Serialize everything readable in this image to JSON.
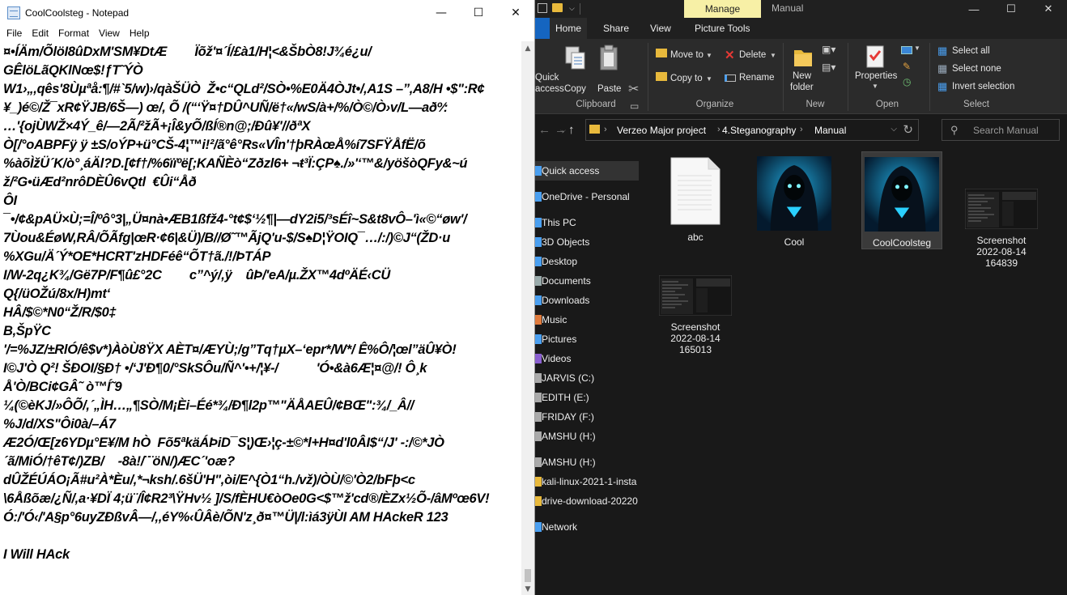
{
  "notepad": {
    "title": "CoolCoolsteg - Notepad",
    "menu": [
      "File",
      "Edit",
      "Format",
      "View",
      "Help"
    ],
    "content_lines": [
      "¤•ÍÄm/ÕlöI8ûDxM'SM¥DtÆ        Ïõž'¤´Í/£à1/H¦<&ŠbÒ8!J¾é¿u/",
      "GÊlöLãQKlNœ$!ƒT˜ÝÒ",
      "W1›„,qês'8Ùµªå:¶/#`5/w)›/qàŠÜÒ  Ž•c“QLd²/SÒ•%E0Ä4ÒJt•/,A1S –”,A8/H •$\":R¢",
      "¥_)é©/Ž¯xR¢ŸJB/6Š—) œ/, Õ /(“‘Ÿ¤†DÛ^UÑ/ë†«/wS/à+/%/Ò©/Ò›v/L—aðº⁄:",
      "…'{ojÙWŽ×4Ý_ê/—2Ã/²žÃ+¡Î&yÕ/ßÍ®n@;/Ðû¥'//ðªX",
      "Ò[/°oABPFÿ ÿ ±S/oÝP+ü°CŠ-4¦™i!²/ã°ê°Rs«VÎn'†þRÀœÅ%í7SFŸÅfË/õ",
      "%àõÌžÜ´K/ò°¸áÄl?D.[¢f†/%6ïïºë[;KAÑÈò“Zðzl6+ ¬ŧ³Ï:ÇP♠./»'‘™&/yöšòQFy&~ú",
      "ž/²G•üÆd²nrôDÈÛ6vQtl  €Ûi“Åð",
      "ÔI",
      "¯•/¢&pAÜ×Ù;=Î/ºô°3|„Ü¤nà•ÆB1ßfž4-°t¢$‘½¶|—dY2i5/³sÉî~S&t8vÔ–'ì«©“øw'/",
      "7Ùou&ÉøW,RÂ/ÕÃfg|œR·¢6|&Ü)/B//Ø˜™ÃjQ'u-$/S♠D¦ŸOIQ¯…/:/)©J“(ŽD·u",
      "%XGu/Ä´Ý*OE*HCRT'zHDFéê“ÕT†ã./!/ÞTÁP",
      "I/W-2q¿K¾/Gë7P/F¶û£°2C        c”^ý/,ÿ    ûÞ/'eA/µ.ŽX™4dºÄÉ‹CÜ",
      "Q{/üOŽú/8x/H)mt‘",
      "HÂ/$©*N0“Ž/R/$0‡",
      "B,ŠpŸC",
      "'/=%JZ/±RlÓ/ê$v*)ÀòÙ8ŸX AÈT¤/ÆYÙ;/g”Tq†µX–‘epr*/W*/ Ê%Ô/¦œl”äÛ¥Ò!",
      "I©J'Ò Q²! ŠÐOI/§Ð† •/‘J'Ð¶0/°SkSÔu/Ñ^'•+/¦¥-/           'Ó•&à6Æ¦¤@/! Ô¸k",
      "Å'Ò/BCi¢GÂ˜ ò™Í˜9",
      "¼(©èKJ/»ÔÕ/,´„ÌH…„¶SÒ/M¡Èi–Éé*¾/Ð¶l2p™\"ÄÅAEÛ/¢BŒ\":¾/_Â//",
      "%J/d/XS\"Ôi0à/–Á7",
      "Æ2Ó/Œ[z6YDµ°E¥/M hÒ  Fõ5ªkäÁÞiD¯S¦)Œ›¦ç-±©*l+H¤d'l0ÂI$“/J' -:/©*JÒ",
      "´ã/MiÓ/†êT¢/)ZB/    -8à!/¨¨öN/)ÆC´'oæ?",
      "dÛŽÉÚÁO¡Ã#u²À*Èu/,*¬ksh/.6šÜ'H\",òi/E^{Ò1“h./vž)/ÒÙ/©'Ò2/bFþ<c",
      "\\6Åßõæ/¿Ñ/,a·¥DÏ 4;ü¨/Î¢R2³\\ŸHv½ ]/S/fÈHU€òOe0G<$™ž'cd®/ÈZx½Õ-/âMºœ6V!",
      "Ó:/'Ó‹/'A§p°6uyZÐßvÂ—/,,éY%‹ÛÂè/ÕN'z¸ð¤™Ü|/l:ìá3ÿÙI AM HAckeR 123",
      "",
      "I Will HAck"
    ]
  },
  "explorer": {
    "title": "Manual",
    "contextual_tab": "Manage",
    "tabs": [
      "Home",
      "Share",
      "View",
      "Picture Tools"
    ],
    "ribbon": {
      "clipboard": {
        "group": "Clipboard",
        "quick_access": [
          "Quick",
          "access"
        ],
        "copy": "Copy",
        "paste": "Paste"
      },
      "organize": {
        "group": "Organize",
        "move_to": "Move to",
        "copy_to": "Copy to",
        "delete": "Delete",
        "rename": "Rename"
      },
      "new": {
        "group": "New",
        "new_folder": [
          "New",
          "folder"
        ]
      },
      "open": {
        "group": "Open",
        "properties": "Properties"
      },
      "select": {
        "group": "Select",
        "select_all": "Select all",
        "select_none": "Select none",
        "invert": "Invert selection"
      }
    },
    "address": {
      "segments": [
        "Verzeo Major project",
        "4.Steganography",
        "Manual"
      ]
    },
    "search": {
      "placeholder": "Search Manual"
    },
    "nav_items": [
      {
        "label": "Quick access",
        "icon": "star-icon",
        "selected": true
      },
      {
        "label": "OneDrive - Personal",
        "icon": "cloud-icon"
      },
      {
        "label": "This PC",
        "icon": "computer-icon"
      },
      {
        "label": "3D Objects",
        "icon": "cube-icon"
      },
      {
        "label": "Desktop",
        "icon": "desktop-icon"
      },
      {
        "label": "Documents",
        "icon": "document-icon"
      },
      {
        "label": "Downloads",
        "icon": "download-icon"
      },
      {
        "label": "Music",
        "icon": "music-icon"
      },
      {
        "label": "Pictures",
        "icon": "picture-icon"
      },
      {
        "label": "Videos",
        "icon": "video-icon"
      },
      {
        "label": "JARVIS (C:)",
        "icon": "drive-icon"
      },
      {
        "label": "EDITH (E:)",
        "icon": "drive-icon"
      },
      {
        "label": "FRIDAY (F:)",
        "icon": "drive-icon"
      },
      {
        "label": "AMSHU (H:)",
        "icon": "drive-icon"
      },
      {
        "label": "AMSHU (H:)",
        "icon": "drive-icon"
      },
      {
        "label": "kali-linux-2021-1-insta",
        "icon": "folder-icon"
      },
      {
        "label": "drive-download-20220",
        "icon": "folder-icon"
      },
      {
        "label": "Network",
        "icon": "network-icon"
      }
    ],
    "files": [
      {
        "name": "abc",
        "kind": "text"
      },
      {
        "name": "Cool",
        "kind": "image"
      },
      {
        "name": "CoolCoolsteg",
        "kind": "image",
        "selected": true
      },
      {
        "name": "Screenshot 2022-08-14 164839",
        "kind": "screenshot"
      },
      {
        "name": "Screenshot 2022-08-14 165013",
        "kind": "screenshot"
      }
    ],
    "colors": {
      "manage_tab": "#f7f0a6",
      "file_tab": "#1565c0",
      "folder": "#e8b93c",
      "background": "#191919"
    }
  }
}
